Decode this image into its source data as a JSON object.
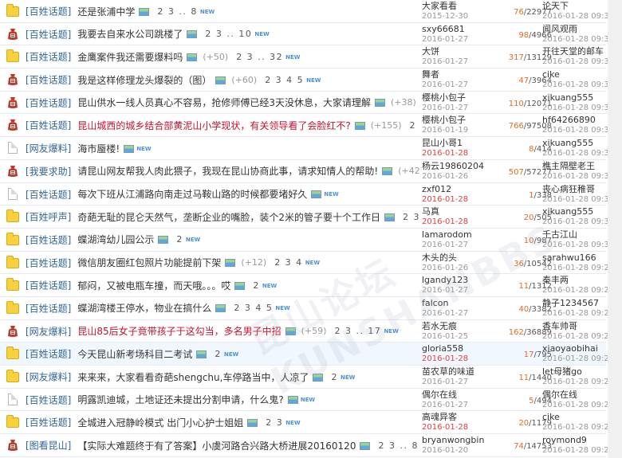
{
  "watermark": "昆山论坛 KUNSHANBBS",
  "threads": [
    {
      "icon": "folder",
      "category": "[百姓话题]",
      "title": "还是张浦中学",
      "hot": false,
      "rate": "",
      "pages": "2 3 .. 8",
      "author": "大家看看",
      "post_date": "2015-12-30",
      "date_today": false,
      "replies": "76",
      "views": "22977",
      "last_user": "论天下",
      "last_date": "2016-01-28 09:33"
    },
    {
      "icon": "bag",
      "category": "[百姓话题]",
      "title": "我要去自来水公司跳楼了",
      "hot": false,
      "rate": "",
      "pages": "2 3 .. 10",
      "author": "sxy66681",
      "post_date": "2016-01-27",
      "date_today": false,
      "replies": "98",
      "views": "4966",
      "last_user": "闻风观雨",
      "last_date": "2016-01-28 09:33"
    },
    {
      "icon": "folder",
      "category": "[百姓话题]",
      "title": "金鹰案件我还需要爆料吗",
      "hot": false,
      "rate": "(+50)",
      "pages": "2 3 .. 32",
      "author": "大饼",
      "post_date": "2016-01-27",
      "date_today": false,
      "replies": "317",
      "views": "13129",
      "last_user": "开往天堂的邮车",
      "last_date": "2016-01-28 09:33"
    },
    {
      "icon": "bag",
      "category": "[百姓话题]",
      "title": "我是这样修理龙头爆裂的（图）",
      "hot": false,
      "rate": "(+60)",
      "pages": "2 3 4 5",
      "author": "舞者",
      "post_date": "2016-01-27",
      "date_today": false,
      "replies": "47",
      "views": "3964",
      "last_user": "cike",
      "last_date": "2016-01-28 09:33"
    },
    {
      "icon": "bag",
      "category": "[百姓话题]",
      "title": "昆山供水一线人员真心不容易，抢修师傅已经3天没休息，大家请理解",
      "hot": false,
      "rate": "(+38)",
      "pages": "2 3 .. 12",
      "author": "樱桃小包子",
      "post_date": "2016-01-27",
      "date_today": false,
      "replies": "110",
      "views": "12071",
      "last_user": "xikuang555",
      "last_date": "2016-01-28 09:32"
    },
    {
      "icon": "bag",
      "category": "[百姓话题]",
      "title": "昆山城西的城乡结合部黄泥山小学现状，有关领导看了会脸红不?",
      "hot": true,
      "rate": "(+155)",
      "pages": "2 3 .. 77",
      "author": "樱桃小包子",
      "post_date": "2016-01-19",
      "date_today": false,
      "replies": "766",
      "views": "97508",
      "last_user": "hf64266890",
      "last_date": "2016-01-28 09:32"
    },
    {
      "icon": "doc",
      "category": "[网友爆料]",
      "title": "海市蜃楼!",
      "hot": false,
      "rate": "",
      "pages": "",
      "author": "昆山小哥1",
      "post_date": "2016-01-28",
      "date_today": true,
      "replies": "8",
      "views": "414",
      "last_user": "xikuang555",
      "last_date": "2016-01-28 09:31"
    },
    {
      "icon": "bag",
      "category": "[我要求助]",
      "title": "请昆山网友帮我人肉此猥子，我现在昆山协商此事，请求知情人的帮助!",
      "hot": false,
      "rate": "(+423)",
      "pages": "2 3 .. 51",
      "author": "杨云19860204",
      "post_date": "2016-01-26",
      "date_today": false,
      "replies": "507",
      "views": "57277",
      "last_user": "樵主隔壁老王",
      "last_date": "2016-01-28 09:31"
    },
    {
      "icon": "doc",
      "category": "[百姓话题]",
      "title": "每次下班从江浦路向南走过马鞍山路的时候都要堵好久",
      "hot": false,
      "rate": "",
      "pages": "",
      "author": "zxf012",
      "post_date": "2016-01-28",
      "date_today": true,
      "replies": "1",
      "views": "338",
      "last_user": "丧心病狂稚哥",
      "last_date": "2016-01-28 09:31"
    },
    {
      "icon": "folder",
      "category": "[百姓呼声]",
      "title": "奇葩无耻的昆仑天然气，垄断企业的嘴脸，装个2米的管子要十个工作日",
      "hot": false,
      "rate": "",
      "pages": "2 3",
      "author": "马真",
      "post_date": "2016-01-28",
      "date_today": true,
      "replies": "20",
      "views": "505",
      "last_user": "xikuang555",
      "last_date": "2016-01-28 09:31"
    },
    {
      "icon": "folder",
      "category": "[百姓话题]",
      "title": "蝶湖湾幼儿园公示",
      "hot": false,
      "rate": "",
      "pages": "2",
      "author": "lamarodom",
      "post_date": "2016-01-27",
      "date_today": false,
      "replies": "10",
      "views": "987",
      "last_user": "千古江山",
      "last_date": "2016-01-28 09:30"
    },
    {
      "icon": "folder",
      "category": "[百姓话题]",
      "title": "微信朋友圈红包照片功能提前下架",
      "hot": false,
      "rate": "(+12)",
      "pages": "2 3 4",
      "author": "木头的头",
      "post_date": "2016-01-26",
      "date_today": false,
      "replies": "36",
      "views": "10542",
      "last_user": "sarahwu166",
      "last_date": "2016-01-28 09:28"
    },
    {
      "icon": "folder",
      "category": "[百姓话题]",
      "title": "郁闷，又被电瓶车撞，而天哦。。。哎",
      "hot": false,
      "rate": "",
      "pages": "2",
      "author": "lgandy123",
      "post_date": "2016-01-27",
      "date_today": false,
      "replies": "11",
      "views": "1312",
      "last_user": "秦丰两",
      "last_date": "2016-01-28 09:27"
    },
    {
      "icon": "folder",
      "category": "[百姓话题]",
      "title": "蝶湖湾楼王停水，物业在搞什么",
      "hot": false,
      "rate": "",
      "pages": "2 3 4 5",
      "author": "falcon",
      "post_date": "2016-01-27",
      "date_today": false,
      "replies": "40",
      "views": "3382",
      "last_user": "静子1234567",
      "last_date": "2016-01-28 09:27"
    },
    {
      "icon": "bag",
      "category": "[网友爆料]",
      "title": "昆山85后女子竟带孩子于这勾当，多名男子中招",
      "hot": true,
      "rate": "(+59)",
      "pages": "2 3 .. 17",
      "author": "若水无痕",
      "post_date": "2016-01-25",
      "date_today": false,
      "replies": "162",
      "views": "36889",
      "last_user": "香车帅哥",
      "last_date": "2016-01-28 09:26"
    },
    {
      "icon": "folder",
      "category": "[百姓话题]",
      "title": "今天昆山新考场科目二考试",
      "hot": false,
      "rate": "",
      "pages": "2",
      "author": "gloria558",
      "post_date": "2016-01-28",
      "date_today": true,
      "replies": "17",
      "views": "795",
      "last_user": "xiaoyaobihai",
      "last_date": "2016-01-28 09:26"
    },
    {
      "icon": "folder",
      "category": "[网友爆料]",
      "title": "来来来，大家看看奇葩shengchu,车停路当中，人凉了",
      "hot": false,
      "rate": "",
      "pages": "2",
      "author": "苗农草的味道",
      "post_date": "2016-01-27",
      "date_today": false,
      "replies": "11",
      "views": "1440",
      "last_user": "let母猪go",
      "last_date": "2016-01-28 09:26"
    },
    {
      "icon": "doc",
      "category": "[百姓话题]",
      "title": "明露凯迪城，土地证还未提出分割申请，什么鬼?",
      "hot": false,
      "rate": "",
      "pages": "",
      "author": "偶尔在线",
      "post_date": "2016-01-27",
      "date_today": false,
      "replies": "5",
      "views": "494",
      "last_user": "偶尔在线",
      "last_date": "2016-01-28 09:25"
    },
    {
      "icon": "folder",
      "category": "[百姓话题]",
      "title": "全城进入冠静岭模式 出门小心护士姐姐",
      "hot": false,
      "rate": "",
      "pages": "2 3",
      "author": "高魂异客",
      "post_date": "2016-01-28",
      "date_today": true,
      "replies": "20",
      "views": "1179",
      "last_user": "cike",
      "last_date": "2016-01-28 09:25"
    },
    {
      "icon": "bag",
      "category": "[图看昆山]",
      "title": "【实际大难题终于有了答案】小虞河路合兴路大桥进展20160120",
      "hot": false,
      "rate": "",
      "pages": "2 3 .. 8",
      "author": "bryanwongbin",
      "post_date": "2016-01-20",
      "date_today": false,
      "replies": "74",
      "views": "14753",
      "last_user": "roymond9",
      "last_date": "2016-01-28 09:24"
    }
  ]
}
